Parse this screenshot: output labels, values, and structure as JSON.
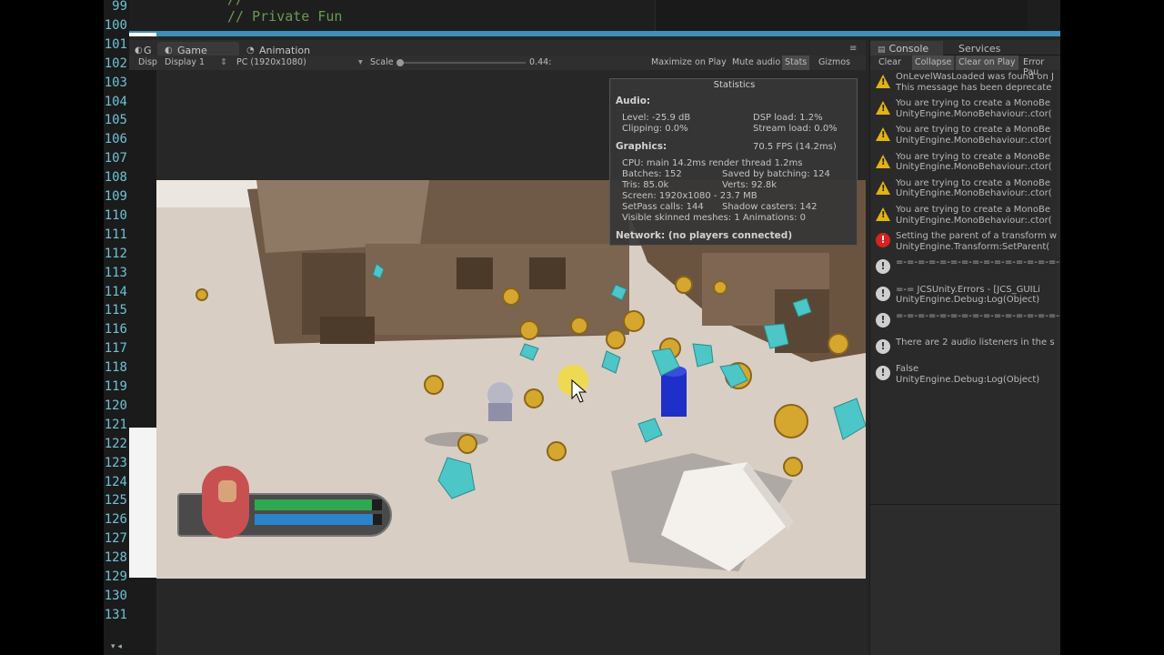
{
  "editor": {
    "line_numbers": [
      "99",
      "100",
      "101",
      "102",
      "103",
      "104",
      "105",
      "106",
      "107",
      "108",
      "109",
      "110",
      "111",
      "112",
      "113",
      "114",
      "115",
      "116",
      "117",
      "118",
      "119",
      "120",
      "121",
      "122",
      "123",
      "124",
      "125",
      "126",
      "127",
      "128",
      "129",
      "130",
      "131"
    ],
    "code_line_1": "//",
    "code_line_2": "// Private Fun"
  },
  "game_tabs": {
    "hidden_tab": "G",
    "game": "Game",
    "animation": "Animation"
  },
  "game_toolbar": {
    "display_short": "Disp",
    "display": "Display 1",
    "resolution": "PC (1920x1080)",
    "scale_label": "Scale",
    "scale_value": "0.44:",
    "maximize": "Maximize on Play",
    "mute": "Mute audio",
    "stats": "Stats",
    "gizmos": "Gizmos"
  },
  "stats": {
    "title": "Statistics",
    "audio_h": "Audio:",
    "level": "Level: -25.9 dB",
    "dsp": "DSP load: 1.2%",
    "clipping": "Clipping: 0.0%",
    "stream": "Stream load: 0.0%",
    "graphics_h": "Graphics:",
    "fps": "70.5 FPS (14.2ms)",
    "cpu": "CPU: main 14.2ms  render thread 1.2ms",
    "batches": "Batches: 152",
    "saved": "Saved by batching: 124",
    "tris": "Tris: 85.0k",
    "verts": "Verts: 92.8k",
    "screen": "Screen: 1920x1080 - 23.7 MB",
    "setpass": "SetPass calls: 144",
    "shadow": "Shadow casters: 142",
    "skinned": "Visible skinned meshes: 1  Animations: 0",
    "network": "Network: (no players connected)"
  },
  "console": {
    "tab_console": "Console",
    "tab_services": "Services",
    "btn_clear": "Clear",
    "btn_collapse": "Collapse",
    "btn_clear_on_play": "Clear on Play",
    "btn_error_pause": "Error Pau",
    "entries": [
      {
        "type": "warn",
        "line1": "OnLevelWasLoaded was found on J",
        "line2": "This message has been deprecate"
      },
      {
        "type": "warn",
        "line1": "You are trying to create a MonoBe",
        "line2": "UnityEngine.MonoBehaviour:.ctor("
      },
      {
        "type": "warn",
        "line1": "You are trying to create a MonoBe",
        "line2": "UnityEngine.MonoBehaviour:.ctor("
      },
      {
        "type": "warn",
        "line1": "You are trying to create a MonoBe",
        "line2": "UnityEngine.MonoBehaviour:.ctor("
      },
      {
        "type": "warn",
        "line1": "You are trying to create a MonoBe",
        "line2": "UnityEngine.MonoBehaviour:.ctor("
      },
      {
        "type": "warn",
        "line1": "You are trying to create a MonoBe",
        "line2": "UnityEngine.MonoBehaviour:.ctor("
      },
      {
        "type": "error",
        "line1": "Setting the parent of a transform w",
        "line2": "UnityEngine.Transform:SetParent("
      },
      {
        "type": "info",
        "line1": "",
        "line2": "=-=-=-=-=-=-=-=-=-=-=-=-=-=-=-="
      },
      {
        "type": "info",
        "line1": "=-= JCSUnity.Errors - [JCS_GUILi",
        "line2": "UnityEngine.Debug:Log(Object)"
      },
      {
        "type": "info",
        "line1": "",
        "line2": "=-=-=-=-=-=-=-=-=-=-=-=-=-=-=-="
      },
      {
        "type": "info",
        "line1": "There are 2 audio listeners in the s",
        "line2": ""
      },
      {
        "type": "info",
        "line1": "False",
        "line2": "UnityEngine.Debug:Log(Object)"
      }
    ]
  },
  "hud": {
    "health_fraction": 0.92,
    "mana_fraction": 0.93
  },
  "colors": {
    "accent_blue": "#3d8fb8",
    "health": "#2fa84f",
    "mana": "#2b84c9"
  }
}
